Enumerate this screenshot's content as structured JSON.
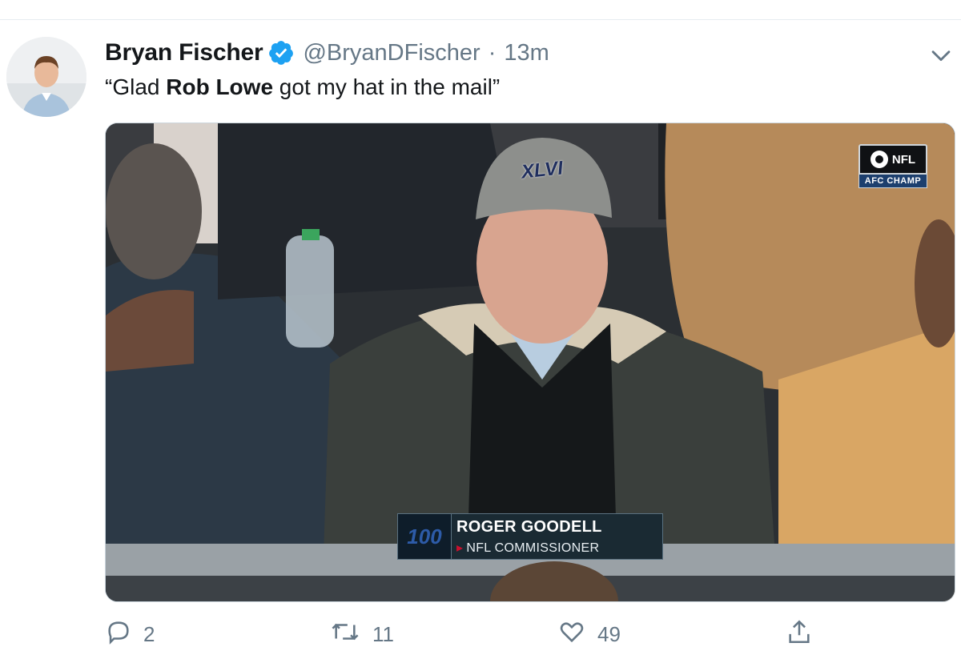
{
  "tweet": {
    "display_name": "Bryan Fischer",
    "handle": "@BryanDFischer",
    "separator": "·",
    "time": "13m",
    "text_before": "“Glad ",
    "text_bold": "Rob Lowe",
    "text_after": " got my hat in the mail”"
  },
  "media": {
    "bug_network": "NFL",
    "bug_event": "AFC CHAMP",
    "lower_third_logo": "100",
    "lower_third_name": "ROGER GOODELL",
    "lower_third_title": "NFL COMMISSIONER",
    "hat_text": "XLVI"
  },
  "actions": {
    "reply_count": "2",
    "retweet_count": "11",
    "like_count": "49"
  },
  "icons": {
    "verified": "verified-badge-icon",
    "caret": "chevron-down-icon",
    "reply": "reply-icon",
    "retweet": "retweet-icon",
    "like": "heart-icon",
    "share": "share-icon"
  },
  "colors": {
    "verified_blue": "#1da1f2",
    "secondary_text": "#657786"
  }
}
